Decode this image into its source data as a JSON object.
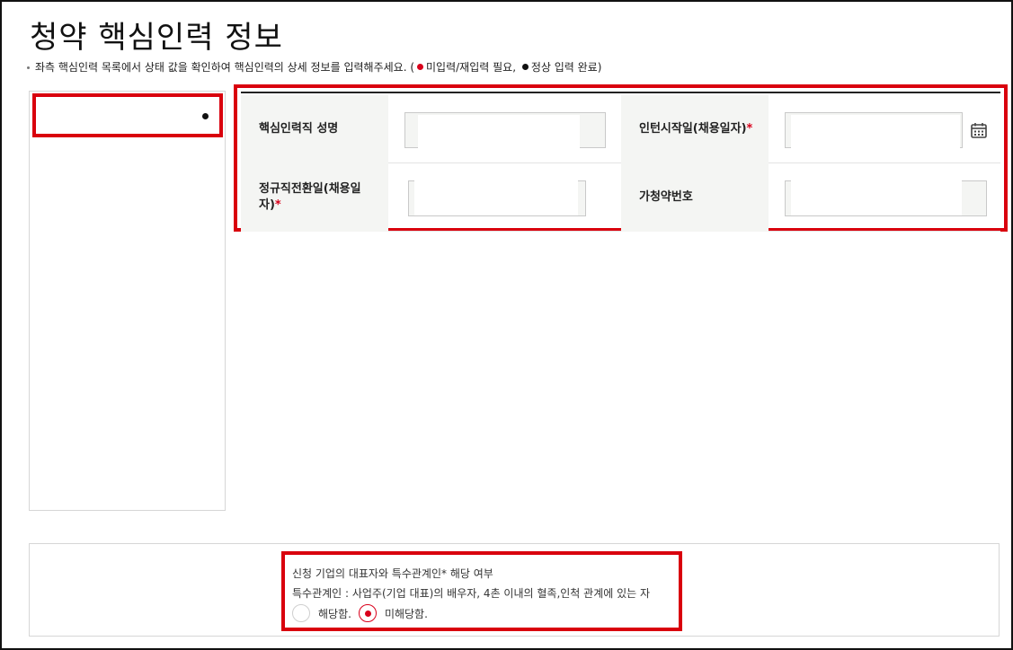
{
  "header": {
    "title": "청약 핵심인력 정보"
  },
  "guide": {
    "text_before": "좌측 핵심인력 목록에서 상태 값을 확인하여 핵심인력의 상세 정보를 입력해주세요. (",
    "red_legend": "미입력/재입력 필요,",
    "black_legend": "정상 입력 완료)"
  },
  "colors": {
    "accent_red": "#d9001b",
    "status_done": "#111111"
  },
  "form": {
    "rows": [
      {
        "left_label": "핵심인력직 성명",
        "left_required": "",
        "right_label": "인턴시작일(채용일자)",
        "right_required": "*"
      },
      {
        "left_label": "정규직전환일(채용일자)",
        "left_required": "*",
        "right_label": "가청약번호",
        "right_required": ""
      }
    ],
    "calendar_icon": "calendar-icon"
  },
  "notice": {
    "line1": "신청 기업의 대표자와 특수관계인* 해당 여부",
    "line2": "특수관계인 : 사업주(기업 대표)의 배우자, 4촌 이내의 혈족,인척 관계에 있는 자",
    "options": [
      {
        "label": "해당함.",
        "checked": false
      },
      {
        "label": "미해당함.",
        "checked": true
      }
    ]
  }
}
